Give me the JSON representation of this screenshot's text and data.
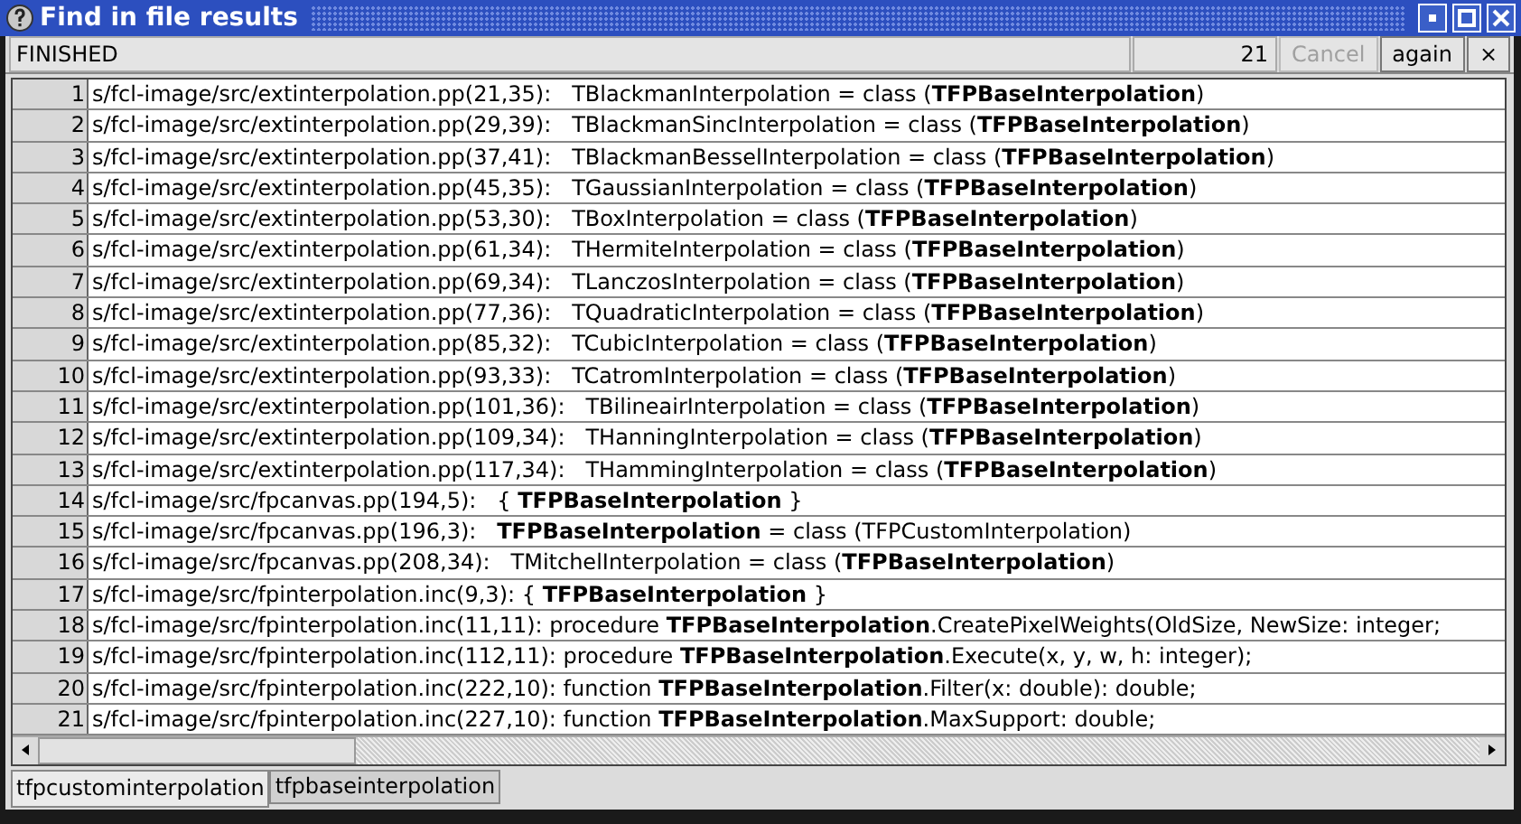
{
  "window": {
    "title": "Find in file results"
  },
  "toolbar": {
    "status": "FINISHED",
    "count": "21",
    "buttons": [
      {
        "label": "Cancel",
        "disabled": true
      },
      {
        "label": "again",
        "disabled": false
      },
      {
        "label": "×",
        "disabled": false
      }
    ]
  },
  "rows": [
    {
      "number": "1",
      "text": "s/fcl-image/src/extinterpolation.pp(21,35):   TBlackmanInterpolation = class (**TFPBaseInterpolation**)"
    },
    {
      "number": "2",
      "text": "s/fcl-image/src/extinterpolation.pp(29,39):   TBlackmanSincInterpolation = class (**TFPBaseInterpolation**)"
    },
    {
      "number": "3",
      "text": "s/fcl-image/src/extinterpolation.pp(37,41):   TBlackmanBesselInterpolation = class (**TFPBaseInterpolation**)"
    },
    {
      "number": "4",
      "text": "s/fcl-image/src/extinterpolation.pp(45,35):   TGaussianInterpolation = class (**TFPBaseInterpolation**)"
    },
    {
      "number": "5",
      "text": "s/fcl-image/src/extinterpolation.pp(53,30):   TBoxInterpolation = class (**TFPBaseInterpolation**)"
    },
    {
      "number": "6",
      "text": "s/fcl-image/src/extinterpolation.pp(61,34):   THermiteInterpolation = class (**TFPBaseInterpolation**)"
    },
    {
      "number": "7",
      "text": "s/fcl-image/src/extinterpolation.pp(69,34):   TLanczosInterpolation = class (**TFPBaseInterpolation**)"
    },
    {
      "number": "8",
      "text": "s/fcl-image/src/extinterpolation.pp(77,36):   TQuadraticInterpolation = class (**TFPBaseInterpolation**)"
    },
    {
      "number": "9",
      "text": "s/fcl-image/src/extinterpolation.pp(85,32):   TCubicInterpolation = class (**TFPBaseInterpolation**)"
    },
    {
      "number": "10",
      "text": "s/fcl-image/src/extinterpolation.pp(93,33):   TCatromInterpolation = class (**TFPBaseInterpolation**)"
    },
    {
      "number": "11",
      "text": "s/fcl-image/src/extinterpolation.pp(101,36):   TBilineairInterpolation = class (**TFPBaseInterpolation**)"
    },
    {
      "number": "12",
      "text": "s/fcl-image/src/extinterpolation.pp(109,34):   THanningInterpolation = class (**TFPBaseInterpolation**)"
    },
    {
      "number": "13",
      "text": "s/fcl-image/src/extinterpolation.pp(117,34):   THammingInterpolation = class (**TFPBaseInterpolation**)"
    },
    {
      "number": "14",
      "text": "s/fcl-image/src/fpcanvas.pp(194,5):   { **TFPBaseInterpolation** }"
    },
    {
      "number": "15",
      "text": "s/fcl-image/src/fpcanvas.pp(196,3):   **TFPBaseInterpolation** = class (TFPCustomInterpolation)"
    },
    {
      "number": "16",
      "text": "s/fcl-image/src/fpcanvas.pp(208,34):   TMitchelInterpolation = class (**TFPBaseInterpolation**)"
    },
    {
      "number": "17",
      "text": "s/fcl-image/src/fpinterpolation.inc(9,3): { **TFPBaseInterpolation** }"
    },
    {
      "number": "18",
      "text": "s/fcl-image/src/fpinterpolation.inc(11,11): procedure **TFPBaseInterpolation**.CreatePixelWeights(OldSize, NewSize: integer;"
    },
    {
      "number": "19",
      "text": "s/fcl-image/src/fpinterpolation.inc(112,11): procedure **TFPBaseInterpolation**.Execute(x, y, w, h: integer);"
    },
    {
      "number": "20",
      "text": "s/fcl-image/src/fpinterpolation.inc(222,10): function **TFPBaseInterpolation**.Filter(x: double): double;"
    },
    {
      "number": "21",
      "text": "s/fcl-image/src/fpinterpolation.inc(227,10): function **TFPBaseInterpolation**.MaxSupport: double;"
    }
  ],
  "tabs": [
    {
      "label": "tfpcustominterpolation",
      "selected": true
    },
    {
      "label": "tfpbaseinterpolation",
      "selected": false
    }
  ]
}
